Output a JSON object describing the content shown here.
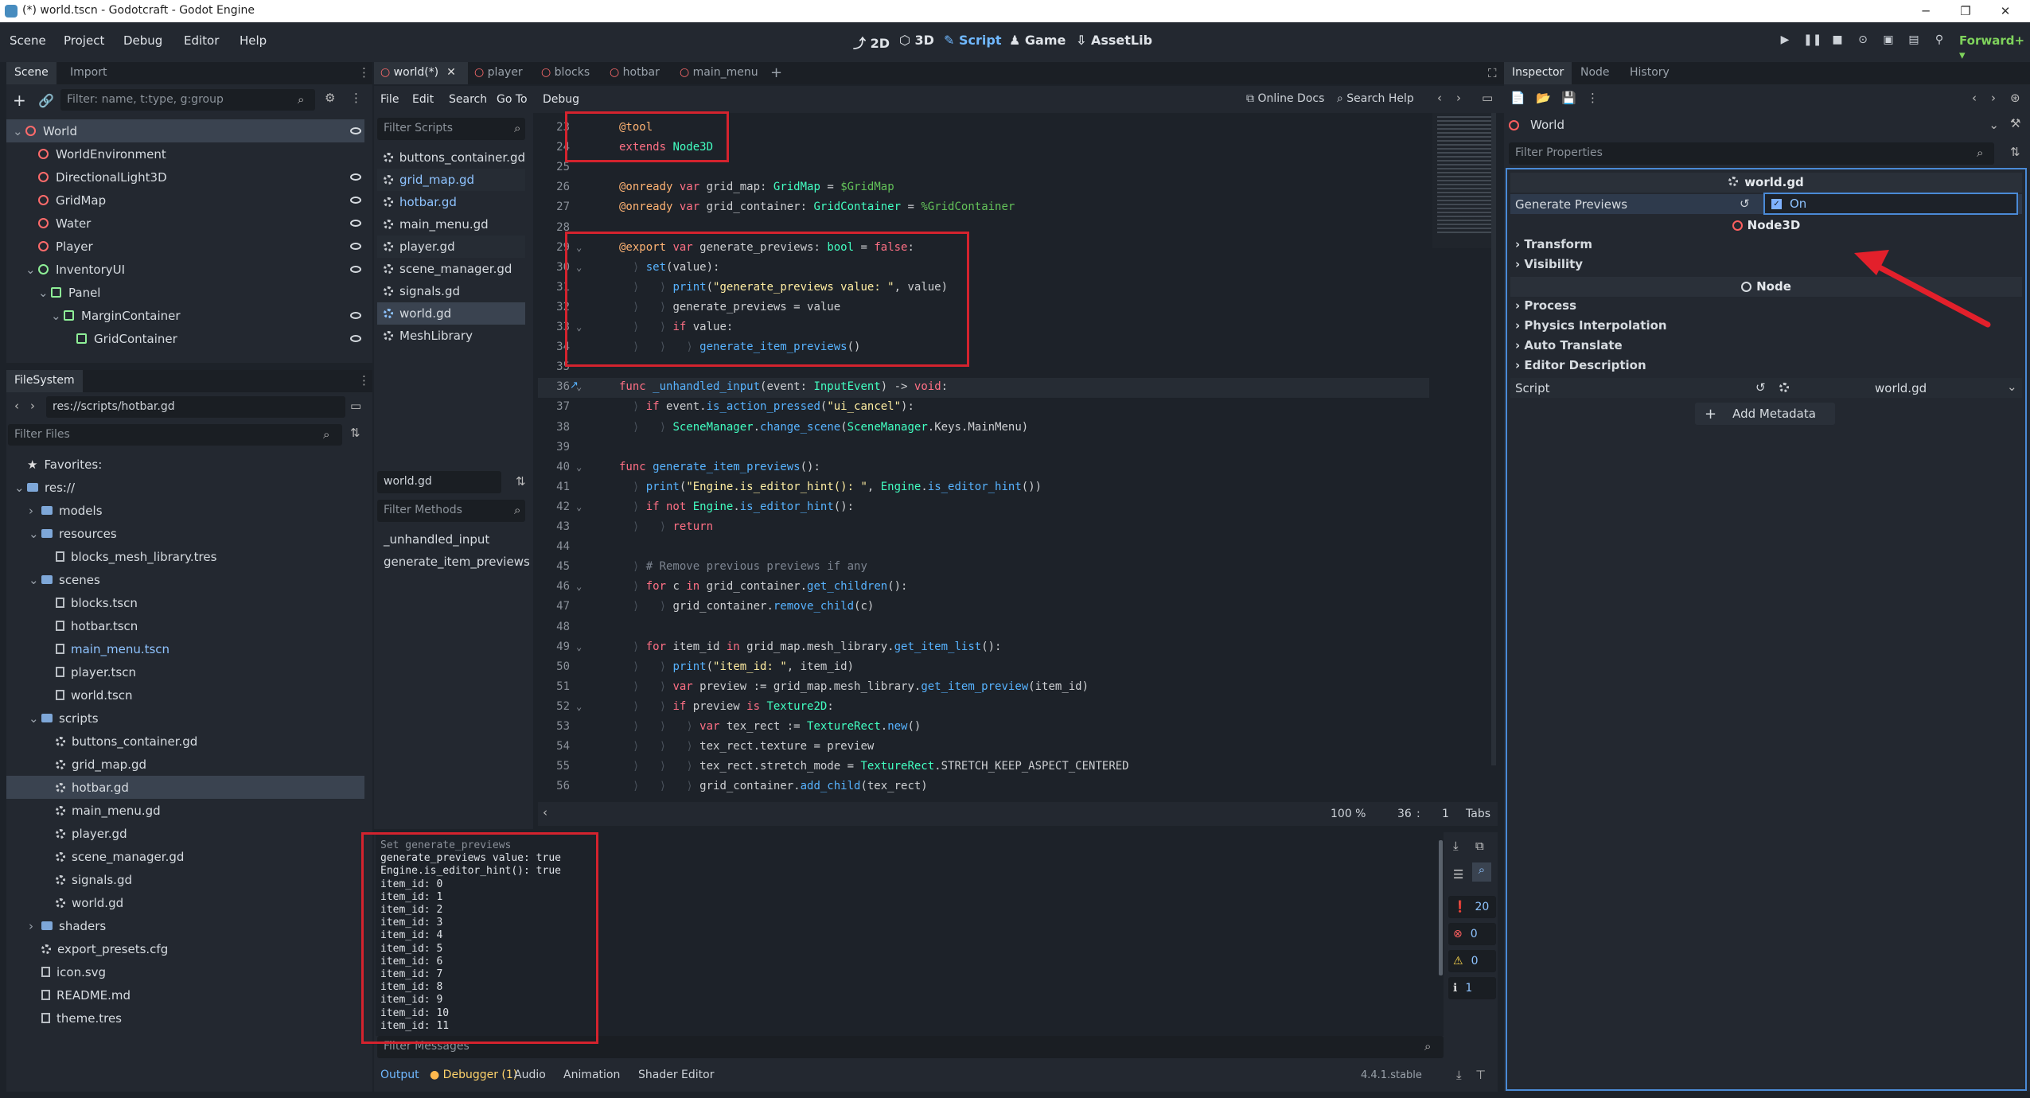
{
  "window": {
    "title": "(*) world.tscn - Godotcraft - Godot Engine"
  },
  "menubar": {
    "items": [
      "Scene",
      "Project",
      "Debug",
      "Editor",
      "Help"
    ],
    "workspaces": [
      "2D",
      "3D",
      "Script",
      "Game",
      "AssetLib"
    ],
    "active_workspace": "Script",
    "renderer": "Forward+"
  },
  "scene_dock": {
    "tabs": [
      "Scene",
      "Import"
    ],
    "filter_placeholder": "Filter: name, t:type, g:group",
    "nodes": [
      {
        "name": "World",
        "depth": 0,
        "color": "#ff6b6b"
      },
      {
        "name": "WorldEnvironment",
        "depth": 1,
        "color": "#ff6b6b"
      },
      {
        "name": "DirectionalLight3D",
        "depth": 1,
        "color": "#ff6b6b"
      },
      {
        "name": "GridMap",
        "depth": 1,
        "color": "#ff6b6b"
      },
      {
        "name": "Water",
        "depth": 1,
        "color": "#ff6b6b"
      },
      {
        "name": "Player",
        "depth": 1,
        "color": "#ff6b6b"
      },
      {
        "name": "InventoryUI",
        "depth": 1,
        "color": "#8eef97"
      },
      {
        "name": "Panel",
        "depth": 2,
        "color": "#8eef97"
      },
      {
        "name": "MarginContainer",
        "depth": 3,
        "color": "#8eef97"
      },
      {
        "name": "GridContainer",
        "depth": 4,
        "color": "#8eef97"
      }
    ]
  },
  "filesystem": {
    "tab": "FileSystem",
    "path": "res://scripts/hotbar.gd",
    "filter_placeholder": "Filter Files",
    "items": [
      {
        "name": "Favorites:",
        "depth": 0,
        "kind": "star"
      },
      {
        "name": "res://",
        "depth": 0,
        "kind": "folder"
      },
      {
        "name": "models",
        "depth": 1,
        "kind": "folder"
      },
      {
        "name": "resources",
        "depth": 1,
        "kind": "folder"
      },
      {
        "name": "blocks_mesh_library.tres",
        "depth": 2,
        "kind": "file"
      },
      {
        "name": "scenes",
        "depth": 1,
        "kind": "folder"
      },
      {
        "name": "blocks.tscn",
        "depth": 2,
        "kind": "file"
      },
      {
        "name": "hotbar.tscn",
        "depth": 2,
        "kind": "file"
      },
      {
        "name": "main_menu.tscn",
        "depth": 2,
        "kind": "file"
      },
      {
        "name": "player.tscn",
        "depth": 2,
        "kind": "file"
      },
      {
        "name": "world.tscn",
        "depth": 2,
        "kind": "file"
      },
      {
        "name": "scripts",
        "depth": 1,
        "kind": "folder"
      },
      {
        "name": "buttons_container.gd",
        "depth": 2,
        "kind": "gear"
      },
      {
        "name": "grid_map.gd",
        "depth": 2,
        "kind": "gear"
      },
      {
        "name": "hotbar.gd",
        "depth": 2,
        "kind": "gear"
      },
      {
        "name": "main_menu.gd",
        "depth": 2,
        "kind": "gear"
      },
      {
        "name": "player.gd",
        "depth": 2,
        "kind": "gear"
      },
      {
        "name": "scene_manager.gd",
        "depth": 2,
        "kind": "gear"
      },
      {
        "name": "signals.gd",
        "depth": 2,
        "kind": "gear"
      },
      {
        "name": "world.gd",
        "depth": 2,
        "kind": "gear"
      },
      {
        "name": "shaders",
        "depth": 1,
        "kind": "folder"
      },
      {
        "name": "export_presets.cfg",
        "depth": 1,
        "kind": "gear"
      },
      {
        "name": "icon.svg",
        "depth": 1,
        "kind": "file"
      },
      {
        "name": "README.md",
        "depth": 1,
        "kind": "file"
      },
      {
        "name": "theme.tres",
        "depth": 1,
        "kind": "file"
      }
    ]
  },
  "script_tabs": [
    "world(*)",
    "player",
    "blocks",
    "hotbar",
    "main_menu"
  ],
  "script_menu": [
    "File",
    "Edit",
    "Search",
    "Go To",
    "Debug"
  ],
  "script_toolbar": {
    "online_docs": "Online Docs",
    "search_help": "Search Help"
  },
  "script_list": {
    "filter_placeholder": "Filter Scripts",
    "items": [
      "buttons_container.gd",
      "grid_map.gd",
      "hotbar.gd",
      "main_menu.gd",
      "player.gd",
      "scene_manager.gd",
      "signals.gd",
      "world.gd",
      "MeshLibrary"
    ],
    "current": "world.gd"
  },
  "methods": {
    "filter_placeholder": "Filter Methods",
    "items": [
      "_unhandled_input",
      "generate_item_previews"
    ]
  },
  "editor_status": {
    "zoom": "100 %",
    "line": "36",
    "col": "1",
    "indent": "Tabs"
  },
  "output": {
    "lines": [
      "Set generate_previews",
      "generate_previews value: true",
      "Engine.is_editor_hint(): true",
      "item_id: 0",
      "item_id: 1",
      "item_id: 2",
      "item_id: 3",
      "item_id: 4",
      "item_id: 5",
      "item_id: 6",
      "item_id: 7",
      "item_id: 8",
      "item_id: 9",
      "item_id: 10",
      "item_id: 11"
    ],
    "filter_placeholder": "Filter Messages",
    "counts": {
      "messages": "20",
      "errors": "0",
      "warnings": "0",
      "other": "1"
    }
  },
  "bottom_tabs": [
    "Output",
    "Debugger (1)",
    "Audio",
    "Animation",
    "Shader Editor"
  ],
  "version": "4.4.1.stable",
  "inspector": {
    "tabs": [
      "Inspector",
      "Node",
      "History"
    ],
    "object": "World",
    "filter_placeholder": "Filter Properties",
    "script_header": "world.gd",
    "property": {
      "name": "Generate Previews",
      "value": "On"
    },
    "node3d_header": "Node3D",
    "node3d_sections": [
      "Transform",
      "Visibility"
    ],
    "node_header": "Node",
    "node_sections": [
      "Process",
      "Physics Interpolation",
      "Auto Translate",
      "Editor Description"
    ],
    "script_label": "Script",
    "script_value": "world.gd",
    "add_metadata": "Add Metadata"
  }
}
